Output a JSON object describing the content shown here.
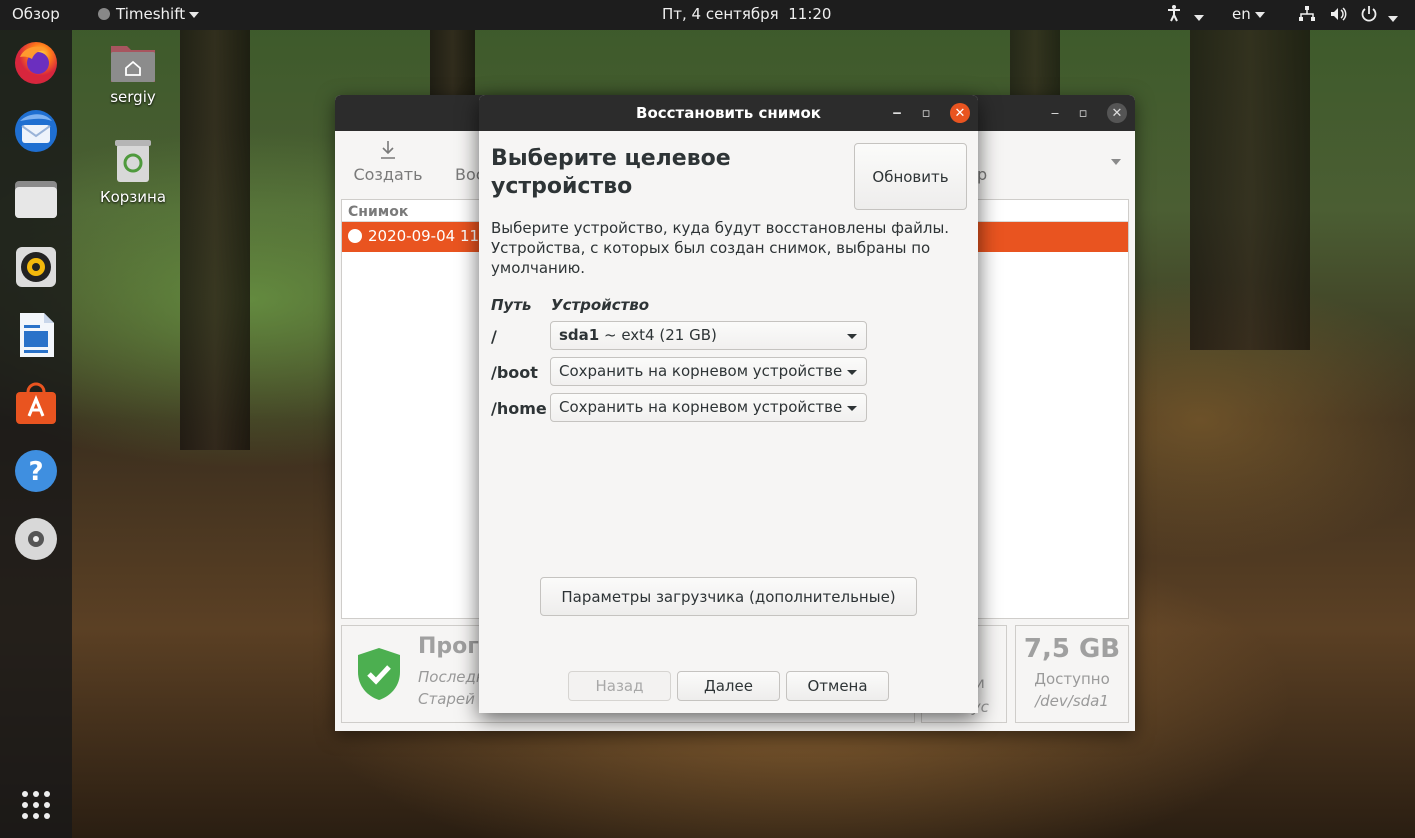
{
  "topbar": {
    "activities": "Обзор",
    "app_menu": "Timeshift",
    "clock": "Пт, 4 сентября  11:20",
    "lang": "en"
  },
  "desktop": {
    "home_label": "sergiy",
    "trash_label": "Корзина"
  },
  "main_window": {
    "toolbar": {
      "create_label": "Создать",
      "restore_label_partial": "Вос"
    },
    "list_header": "Снимок",
    "selected_row_partial": "2020-09-04 11",
    "status": {
      "title_partial": "Прог",
      "line1_partial": "Последн",
      "line2_partial": "Старей"
    },
    "middle_partial": {
      "line1": "ки",
      "line2": "нус"
    },
    "space": {
      "value": "7,5 GB",
      "label": "Доступно",
      "device": "/dev/sda1"
    }
  },
  "dialog": {
    "title": "Восстановить снимок",
    "heading": "Выберите целевое устройство",
    "refresh_button": "Обновить",
    "description": "Выберите устройство, куда будут восстановлены файлы. Устройства, с которых был создан снимок, выбраны по умолчанию.",
    "col_path": "Путь",
    "col_device": "Устройство",
    "rows": [
      {
        "path": "/",
        "device_bold": "sda1",
        "device_rest": " ~ ext4 (21 GB)"
      },
      {
        "path": "/boot",
        "device_bold": "",
        "device_rest": "Сохранить на корневом устройстве"
      },
      {
        "path": "/home",
        "device_bold": "",
        "device_rest": "Сохранить на корневом устройстве"
      }
    ],
    "bootloader_button": "Параметры загрузчика (дополнительные)",
    "back_button": "Назад",
    "next_button": "Далее",
    "cancel_button": "Отмена"
  },
  "colors": {
    "accent": "#e95420",
    "titlebar": "#2c2c2c",
    "window_bg": "#f6f5f4",
    "shield_green": "#4caf50"
  }
}
